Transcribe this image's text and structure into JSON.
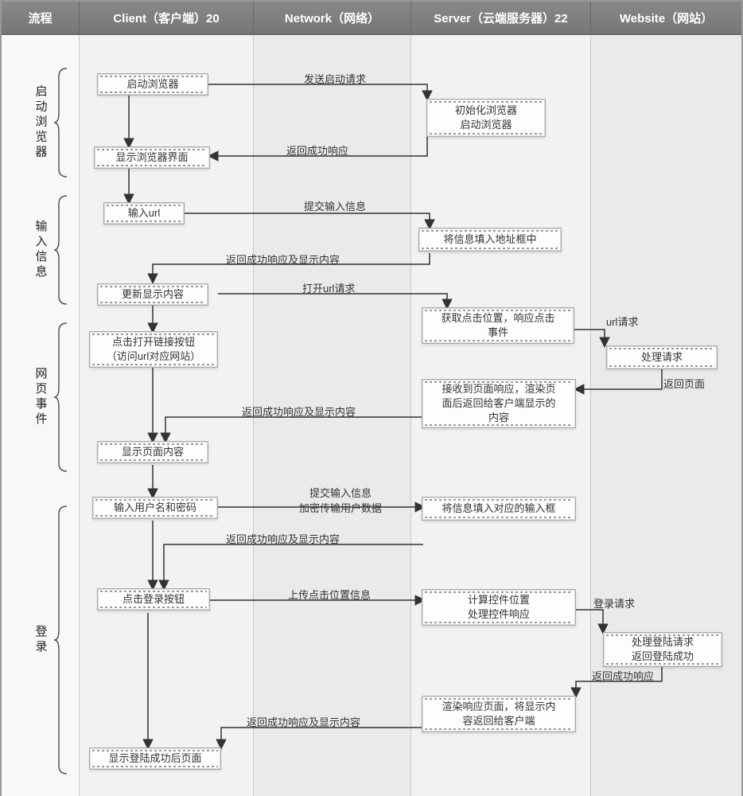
{
  "header": {
    "col0": "流程",
    "col1": "Client（客户端）20",
    "col2": "Network（网络）",
    "col3": "Server（云端服务器）22",
    "col4": "Website（网站）"
  },
  "stages": {
    "s1": "启动浏览器",
    "s2": "输入信息",
    "s3": "网页事件",
    "s4": "登录"
  },
  "boxes": {
    "b1": "启动浏览器",
    "b2": "初始化浏览器\n启动浏览器",
    "b3": "显示浏览器界面",
    "b4": "输入url",
    "b5": "将信息填入地址框中",
    "b6": "更新显示内容",
    "b7": "点击打开链接按钮\n（访问url对应网站）",
    "b8": "获取点击位置，响应点击\n事件",
    "b9": "处理请求",
    "b10": "接收到页面响应，渲染页\n面后返回给客户端显示的\n内容",
    "b11": "显示页面内容",
    "b12": "输入用户名和密码",
    "b13": "将信息填入对应的输入框",
    "b14": "点击登录按钮",
    "b15": "计算控件位置\n处理控件响应",
    "b16": "处理登陆请求\n返回登陆成功",
    "b17": "渲染响应页面，将显示内\n容返回给客户端",
    "b18": "显示登陆成功后页面"
  },
  "messages": {
    "m1": "发送启动请求",
    "m2": "返回成功响应",
    "m3": "提交输入信息",
    "m4": "返回成功响应及显示内容",
    "m5": "打开url请求",
    "m6": "url请求",
    "m7": "返回页面",
    "m8": "返回成功响应及显示内容",
    "m9": "提交输入信息\n加密传输用户数据",
    "m10": "返回成功响应及显示内容",
    "m11": "上传点击位置信息",
    "m12": "登录请求",
    "m13": "返回成功响应",
    "m14": "返回成功响应及显示内容"
  }
}
